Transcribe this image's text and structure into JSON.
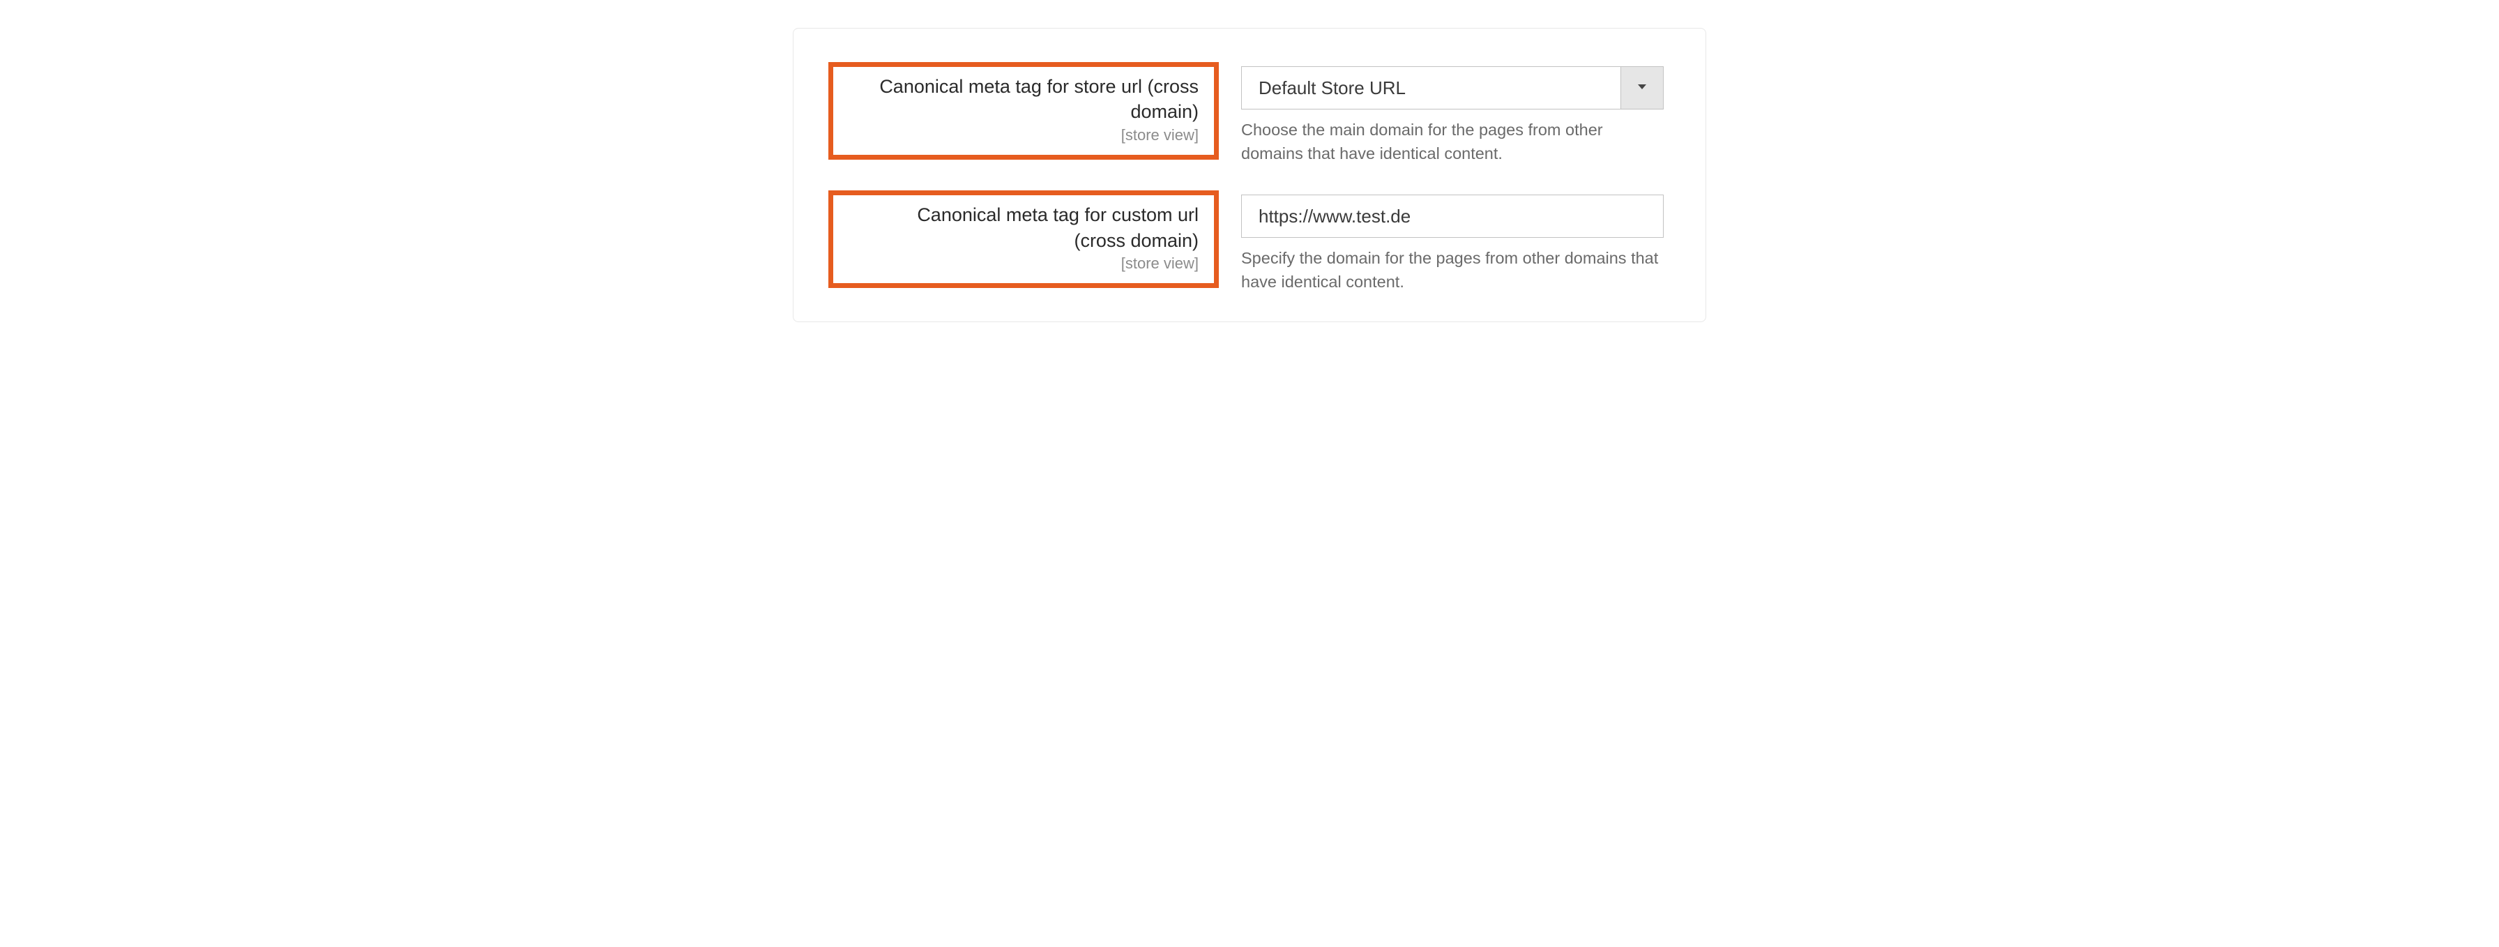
{
  "fields": {
    "store_url": {
      "label": "Canonical meta tag for store url (cross domain)",
      "scope": "[store view]",
      "value": "Default Store URL",
      "help": "Choose the main domain for the pages from other domains that have identical content."
    },
    "custom_url": {
      "label": "Canonical meta tag for custom url (cross domain)",
      "scope": "[store view]",
      "value": "https://www.test.de",
      "help": "Specify the domain for the pages from other domains that have identical content."
    }
  }
}
